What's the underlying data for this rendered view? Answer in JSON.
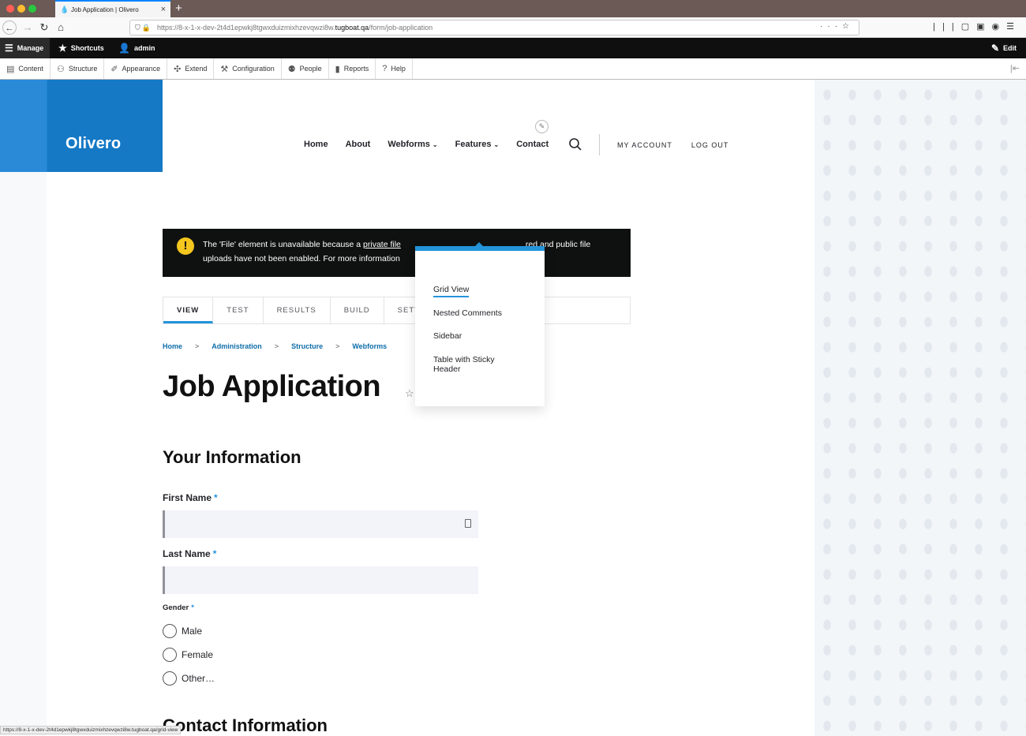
{
  "browser": {
    "tab_title": "Job Application | Olivero",
    "tab_close": "×",
    "new_tab": "+",
    "url_prefix": "https://8-x-1-x-dev-2t4d1epwkj8tgwxduizmixhzevqwzi8w.",
    "url_domain": "tugboat.qa",
    "url_path": "/form/job-application",
    "status_url": "https://8-x-1-x-dev-2t4d1epwkj8tgwxduizmixhzevqwzi8w.tugboat.qa/grid-view"
  },
  "admin_toolbar": {
    "manage": "Manage",
    "shortcuts": "Shortcuts",
    "user": "admin",
    "edit": "Edit"
  },
  "admin_menu": [
    {
      "label": "Content",
      "icon": "file-icon"
    },
    {
      "label": "Structure",
      "icon": "sitemap-icon"
    },
    {
      "label": "Appearance",
      "icon": "brush-icon"
    },
    {
      "label": "Extend",
      "icon": "puzzle-icon"
    },
    {
      "label": "Configuration",
      "icon": "wrench-icon"
    },
    {
      "label": "People",
      "icon": "people-icon"
    },
    {
      "label": "Reports",
      "icon": "chart-icon"
    },
    {
      "label": "Help",
      "icon": "help-icon"
    }
  ],
  "site": {
    "name": "Olivero",
    "brand_color": "#1579c5"
  },
  "primary_nav": {
    "home": "Home",
    "about": "About",
    "webforms": "Webforms",
    "features": "Features",
    "contact": "Contact"
  },
  "secondary_nav": {
    "my_account": "MY ACCOUNT",
    "log_out": "LOG OUT"
  },
  "dropdown": {
    "items": [
      "Grid View",
      "Nested Comments",
      "Sidebar",
      "Table with Sticky Header"
    ]
  },
  "message": {
    "line1_a": "The 'File' element is unavailable because a ",
    "line1_link": "private file",
    "line1_b": "red and public file",
    "line2": "uploads have not been enabled. For more information"
  },
  "tabs": [
    "VIEW",
    "TEST",
    "RESULTS",
    "BUILD",
    "SETTI"
  ],
  "breadcrumb": [
    "Home",
    "Administration",
    "Structure",
    "Webforms"
  ],
  "breadcrumb_sep": ">",
  "page_title": "Job Application",
  "form": {
    "section1": "Your Information",
    "first_name": "First Name",
    "last_name": "Last Name",
    "required_mark": "*",
    "gender": "Gender",
    "gender_options": [
      "Male",
      "Female",
      "Other…"
    ],
    "section2": "Contact Information"
  }
}
